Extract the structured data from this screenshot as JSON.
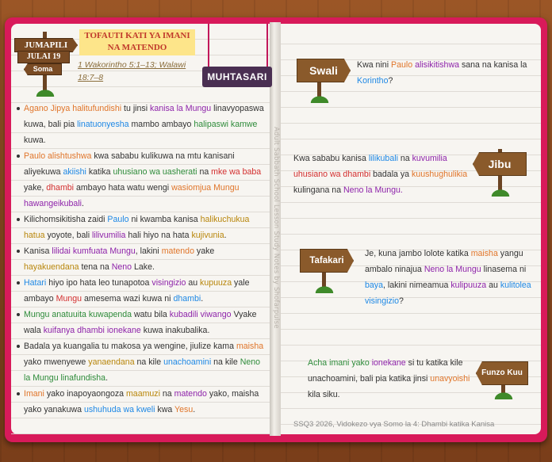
{
  "day_sign": {
    "day": "JUMAPILI",
    "date": "JULAI 19",
    "tag": "Soma"
  },
  "title": "TOFAUTI KATI YA IMANI NA MATENDO",
  "reference": "1 Wakorintho 5:1–13; Walawi 18:7–8",
  "banner": "MUHTASARI",
  "vertical_note": "Adult Sabbath School Lesson Study Notes by Shofarpulse",
  "bullets": [
    [
      [
        "Agano Jipya halitufundishi",
        "or"
      ],
      [
        " tu jinsi ",
        ""
      ],
      [
        "kanisa la Mungu",
        "pu"
      ],
      [
        " linavyopaswa kuwa, bali pia ",
        ""
      ],
      [
        "linatuonyesha",
        "bl"
      ],
      [
        " mambo ambayo ",
        ""
      ],
      [
        "halipaswi kamwe",
        "gr"
      ],
      [
        " kuwa.",
        ""
      ]
    ],
    [
      [
        "Paulo alishtushwa",
        "or"
      ],
      [
        " kwa sababu kulikuwa na mtu kanisani aliyekuwa ",
        ""
      ],
      [
        "akiishi",
        "bl"
      ],
      [
        " katika ",
        ""
      ],
      [
        "uhusiano wa uasherati",
        "gr"
      ],
      [
        " na ",
        ""
      ],
      [
        "mke wa baba",
        "rd"
      ],
      [
        " yake, ",
        ""
      ],
      [
        "dhambi",
        "rd"
      ],
      [
        " ambayo hata watu wengi ",
        ""
      ],
      [
        "wasiomjua Mungu",
        "or"
      ],
      [
        " ",
        ""
      ],
      [
        "hawangeikubali",
        "pu"
      ],
      [
        ".",
        ""
      ]
    ],
    [
      [
        "Kilichomsikitisha zaidi ",
        ""
      ],
      [
        "Paulo",
        "bl"
      ],
      [
        " ni kwamba kanisa ",
        ""
      ],
      [
        "halikuchukua hatua",
        "br"
      ],
      [
        " yoyote, bali ",
        ""
      ],
      [
        "lilivumilia",
        "pu"
      ],
      [
        " hali hiyo na hata ",
        ""
      ],
      [
        "kujivunia",
        "br"
      ],
      [
        ".",
        ""
      ]
    ],
    [
      [
        "Kanisa ",
        ""
      ],
      [
        "lilidai kumfuata Mungu",
        "pu"
      ],
      [
        ", lakini ",
        ""
      ],
      [
        "matendo",
        "or"
      ],
      [
        " yake ",
        ""
      ],
      [
        "hayakuendana",
        "br"
      ],
      [
        " tena na ",
        ""
      ],
      [
        "Neno",
        "pu"
      ],
      [
        " Lake.",
        ""
      ]
    ],
    [
      [
        "Hatari",
        "bl"
      ],
      [
        " hiyo ipo hata leo tunapotoa ",
        ""
      ],
      [
        "visingizio",
        "pu"
      ],
      [
        " au ",
        ""
      ],
      [
        "kupuuza",
        "br"
      ],
      [
        " yale ambayo ",
        ""
      ],
      [
        "Mungu",
        "rd"
      ],
      [
        " amesema wazi kuwa ni ",
        ""
      ],
      [
        "dhambi",
        "bl"
      ],
      [
        ".",
        ""
      ]
    ],
    [
      [
        "Mungu anatuuita kuwapenda",
        "gr"
      ],
      [
        " watu bila ",
        ""
      ],
      [
        "kubadili viwango",
        "pu"
      ],
      [
        " Vyake wala ",
        ""
      ],
      [
        "kuifanya dhambi ionekane",
        "pu"
      ],
      [
        " kuwa inakubalika.",
        ""
      ]
    ],
    [
      [
        "Badala ya kuangalia tu makosa ya wengine, jiulize kama ",
        ""
      ],
      [
        "maisha",
        "or"
      ],
      [
        " yako mwenyewe ",
        ""
      ],
      [
        "yanaendana",
        "br"
      ],
      [
        " na kile ",
        ""
      ],
      [
        "unachoamini",
        "bl"
      ],
      [
        " na kile ",
        ""
      ],
      [
        "Neno la Mungu linafundisha",
        "gr"
      ],
      [
        ".",
        ""
      ]
    ],
    [
      [
        "Imani",
        "or"
      ],
      [
        " yako inapoyaongoza ",
        ""
      ],
      [
        "maamuzi",
        "br"
      ],
      [
        " na ",
        ""
      ],
      [
        "matendo",
        "pu"
      ],
      [
        " yako, maisha yako yanakuwa ",
        ""
      ],
      [
        "ushuhuda wa kweli",
        "bl"
      ],
      [
        " kwa ",
        ""
      ],
      [
        "Yesu",
        "or"
      ],
      [
        ".",
        ""
      ]
    ]
  ],
  "swali": {
    "label": "Swali",
    "text": [
      [
        "Kwa nini ",
        ""
      ],
      [
        "Paulo",
        "or"
      ],
      [
        " ",
        ""
      ],
      [
        "alisikitishwa",
        "pu"
      ],
      [
        " sana na kanisa la ",
        ""
      ],
      [
        "Korintho",
        "bl"
      ],
      [
        "?",
        ""
      ]
    ]
  },
  "jibu": {
    "label": "Jibu",
    "text": [
      [
        "Kwa sababu kanisa ",
        ""
      ],
      [
        "lilikubali",
        "bl"
      ],
      [
        " na ",
        ""
      ],
      [
        "kuvumilia",
        "pu"
      ],
      [
        " ",
        ""
      ],
      [
        "uhusiano wa dhambi",
        "rd"
      ],
      [
        " badala ya ",
        ""
      ],
      [
        "kuushughulikia",
        "or"
      ],
      [
        " kulingana na ",
        ""
      ],
      [
        "Neno la Mungu.",
        "pu"
      ]
    ]
  },
  "tafakari": {
    "label": "Tafakari",
    "text": [
      [
        "Je, kuna jambo lolote katika ",
        ""
      ],
      [
        "maisha",
        "or"
      ],
      [
        " yangu ambalo ninajua ",
        ""
      ],
      [
        "Neno la Mungu",
        "pu"
      ],
      [
        " linasema ni ",
        ""
      ],
      [
        "baya",
        "bl"
      ],
      [
        ", lakini nimeamua ",
        ""
      ],
      [
        "kulipuuza",
        "pu"
      ],
      [
        " au ",
        ""
      ],
      [
        "kulitolea visingizio",
        "bl"
      ],
      [
        "?",
        ""
      ]
    ]
  },
  "funzo": {
    "label": "Funzo Kuu",
    "text": [
      [
        "Acha imani yako",
        "gr"
      ],
      [
        " ",
        ""
      ],
      [
        "ionekane",
        "pu"
      ],
      [
        " si tu katika kile unachoamini, bali pia katika jinsi ",
        ""
      ],
      [
        "unavyoishi",
        "or"
      ],
      [
        " kila siku.",
        ""
      ]
    ]
  },
  "footer": "SSQ3 2026, Vidokezo vya Somo la 4: Dhambi katika Kanisa"
}
